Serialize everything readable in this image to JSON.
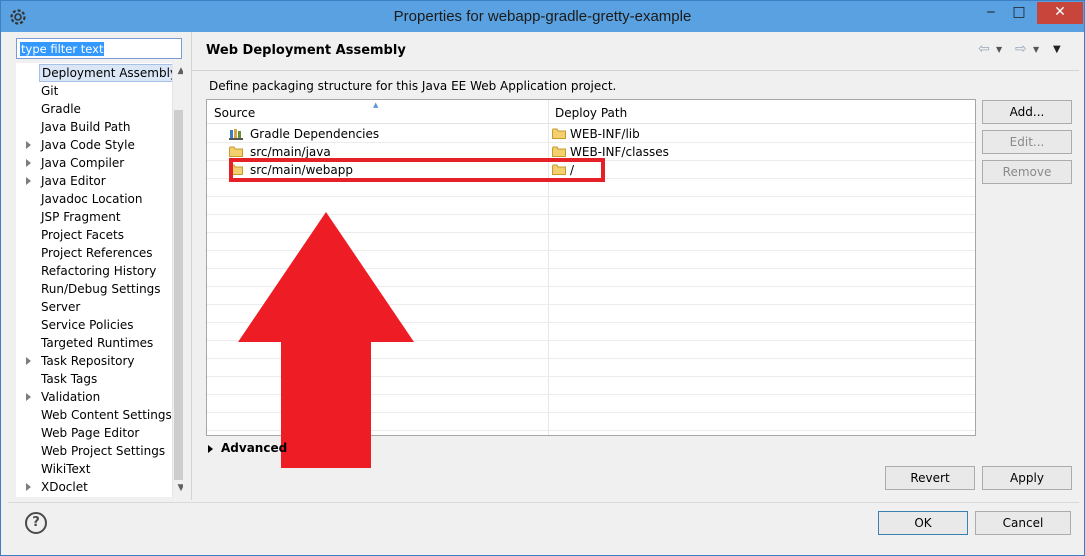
{
  "window": {
    "title": "Properties for webapp-gradle-gretty-example",
    "minimize": "‒",
    "maximize": "□",
    "close": "✕"
  },
  "filter": {
    "value": "type filter text"
  },
  "tree": {
    "items": [
      {
        "label": "Deployment Assembly",
        "expandable": false,
        "selected": true
      },
      {
        "label": "Git",
        "expandable": false
      },
      {
        "label": "Gradle",
        "expandable": false
      },
      {
        "label": "Java Build Path",
        "expandable": false
      },
      {
        "label": "Java Code Style",
        "expandable": true
      },
      {
        "label": "Java Compiler",
        "expandable": true
      },
      {
        "label": "Java Editor",
        "expandable": true
      },
      {
        "label": "Javadoc Location",
        "expandable": false
      },
      {
        "label": "JSP Fragment",
        "expandable": false
      },
      {
        "label": "Project Facets",
        "expandable": false
      },
      {
        "label": "Project References",
        "expandable": false
      },
      {
        "label": "Refactoring History",
        "expandable": false
      },
      {
        "label": "Run/Debug Settings",
        "expandable": false
      },
      {
        "label": "Server",
        "expandable": false
      },
      {
        "label": "Service Policies",
        "expandable": false
      },
      {
        "label": "Targeted Runtimes",
        "expandable": false
      },
      {
        "label": "Task Repository",
        "expandable": true
      },
      {
        "label": "Task Tags",
        "expandable": false
      },
      {
        "label": "Validation",
        "expandable": true
      },
      {
        "label": "Web Content Settings",
        "expandable": false
      },
      {
        "label": "Web Page Editor",
        "expandable": false
      },
      {
        "label": "Web Project Settings",
        "expandable": false
      },
      {
        "label": "WikiText",
        "expandable": false
      },
      {
        "label": "XDoclet",
        "expandable": true
      }
    ]
  },
  "page": {
    "title": "Web Deployment Assembly",
    "description": "Define packaging structure for this Java EE Web Application project.",
    "table": {
      "columns": [
        "Source",
        "Deploy Path"
      ],
      "rows": [
        {
          "source": "Gradle Dependencies",
          "source_icon": "gradle-library-icon",
          "deploy": "WEB-INF/lib"
        },
        {
          "source": "src/main/java",
          "source_icon": "folder-icon",
          "deploy": "WEB-INF/classes"
        },
        {
          "source": "src/main/webapp",
          "source_icon": "folder-icon",
          "deploy": "/"
        }
      ]
    },
    "buttons": {
      "add": "Add...",
      "edit": "Edit...",
      "remove": "Remove"
    },
    "advanced": "Advanced",
    "revert": "Revert",
    "apply": "Apply"
  },
  "footer": {
    "ok": "OK",
    "cancel": "Cancel"
  },
  "colors": {
    "titlebar": "#5aa1e1",
    "close": "#c7453a",
    "highlight": "#e52027",
    "selection": "#3399ff",
    "folder": "#e8b84a"
  }
}
